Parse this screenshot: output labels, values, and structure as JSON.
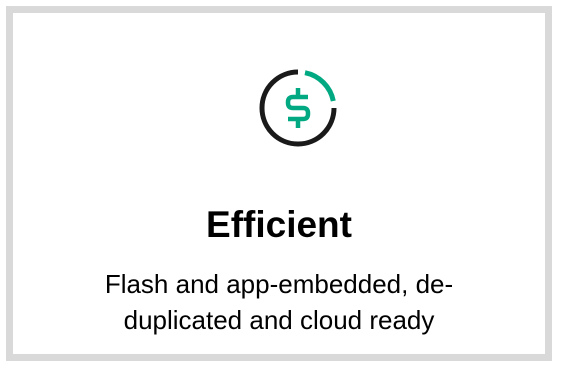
{
  "card": {
    "title": "Efficient",
    "description_line1": "Flash and app-embedded, de-",
    "description_line2": "duplicated and cloud ready"
  },
  "icon": {
    "name": "dollar-circle-icon",
    "accent_color": "#01a982",
    "ring_color": "#1a1a1a"
  },
  "colors": {
    "border": "#d9d9d9",
    "text": "#000000",
    "background": "#ffffff"
  }
}
